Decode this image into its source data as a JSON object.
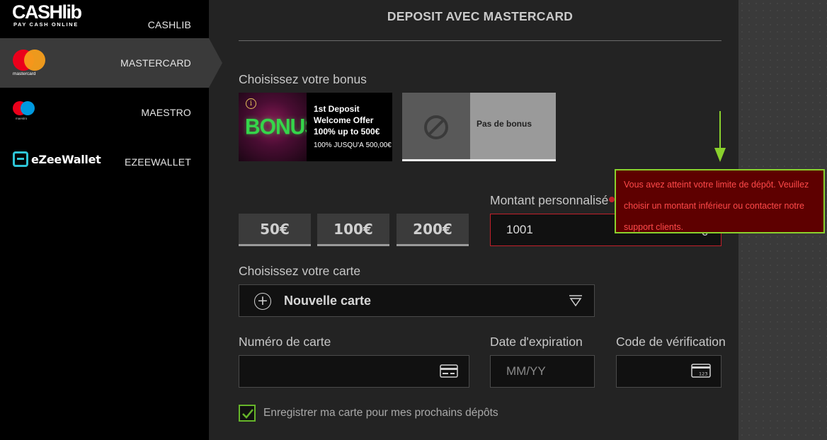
{
  "sidebar": {
    "items": [
      {
        "id": "cashlib",
        "label": "CASHLIB",
        "logo_text": "CASHlib",
        "logo_tagline": "PAY CASH ONLINE"
      },
      {
        "id": "mastercard",
        "label": "MASTERCARD",
        "logo_text": "mastercard",
        "active": true
      },
      {
        "id": "maestro",
        "label": "MAESTRO",
        "logo_text": "maestro"
      },
      {
        "id": "ezeewallet",
        "label": "EZEEWALLET",
        "logo_text": "eZeeWallet"
      }
    ]
  },
  "main": {
    "title": "DEPOSIT AVEC MASTERCARD",
    "bonus_section_label": "Choisissez votre bonus",
    "bonuses": [
      {
        "image_text": "BONUS",
        "title": "1st Deposit Welcome Offer 100% up to 500€",
        "subtitle": "100% JUSQU'À 500,00€",
        "info_icon": "i"
      },
      {
        "title": "Pas de bonus",
        "selected": true
      }
    ],
    "amount_buttons": [
      "50€",
      "100€",
      "200€"
    ],
    "custom_amount": {
      "label": "Montant personnalisé",
      "value": "1001",
      "currency": "€",
      "error_message": "Vous avez atteint votre limite de dépôt. Veuillez choisir un montant inférieur ou contacter notre support clients."
    },
    "card_section_label": "Choisissez votre carte",
    "card_select": {
      "plus_glyph": "+",
      "value": "Nouvelle carte"
    },
    "card_number": {
      "label": "Numéro de carte",
      "placeholder": ""
    },
    "expiry": {
      "label": "Date d'expiration",
      "placeholder": "MM/YY"
    },
    "cvv": {
      "label": "Code de vérification",
      "placeholder": "",
      "icon_text": "123"
    },
    "save_card": {
      "label": "Enregistrer ma carte pour mes prochains dépôts",
      "checked": true
    }
  },
  "colors": {
    "error_red": "#c2202a",
    "tooltip_bg": "#5e0000",
    "highlight_green": "#8ad12d",
    "checkbox_green": "#66b52a"
  }
}
